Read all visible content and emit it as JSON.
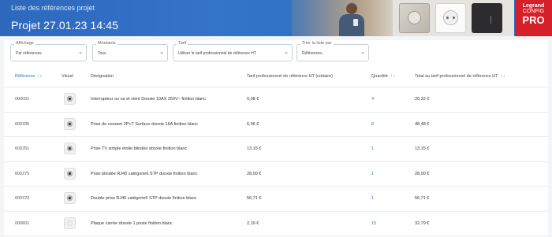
{
  "header": {
    "subtitle": "Liste des références projet",
    "title": "Projet 27.01.23 14:45",
    "brand": {
      "line1": "Legrand",
      "line2": "CONFIG",
      "line3": "PRO"
    }
  },
  "filters": [
    {
      "label": "Affichage",
      "value": "Par références"
    },
    {
      "label": "Montants",
      "value": "Tous"
    },
    {
      "label": "Tarif",
      "value": "Utiliser le tarif professionnel de référence HT"
    },
    {
      "label": "Trier la liste par",
      "value": "Références"
    }
  ],
  "table": {
    "columns": {
      "reference": "Référence",
      "visual": "Visuel",
      "designation": "Désignation",
      "unit_price": "Tarif professionnel de référence HT (unitaire)",
      "quantity": "Quantité",
      "total": "Total au tarif professionnel de référence HT"
    },
    "sort_icon": "↑↓",
    "rows": [
      {
        "ref": "000001",
        "designation": "Interrupteur ou va et vient Dooxie 10AX 250V~ finition blanc",
        "unit_price": "0,08 €",
        "quantity": "4",
        "total": "20,32 €",
        "icon": "switch-thumbnail"
      },
      {
        "ref": "600335",
        "designation": "Prise de courant 2P+T Surface dooxie 16A finition blanc",
        "unit_price": "6,06 €",
        "quantity": "8",
        "total": "48,48 €",
        "icon": "socket-thumbnail"
      },
      {
        "ref": "600351",
        "designation": "Prise TV simple étoile blindée dooxie finition blanc",
        "unit_price": "13,15 €",
        "quantity": "1",
        "total": "13,15 €",
        "icon": "tv-socket-thumbnail"
      },
      {
        "ref": "600275",
        "designation": "Prise blindée RJ45 catégorie6 STP dooxie finition blanc",
        "unit_price": "28,00 €",
        "quantity": "1",
        "total": "28,00 €",
        "icon": "rj45-thumbnail"
      },
      {
        "ref": "600370",
        "designation": "Double prise RJ45 catégorie6 STP dooxie finition blanc",
        "unit_price": "56,71 €",
        "quantity": "1",
        "total": "56,71 €",
        "icon": "double-rj45-thumbnail"
      },
      {
        "ref": "000801",
        "designation": "Plaque carrée dooxie 1 poste finition blanc",
        "unit_price": "2,19 €",
        "quantity": "15",
        "total": "32,79 €",
        "icon": "plate-thumbnail"
      }
    ]
  },
  "colors": {
    "accent": "#2f6fc4",
    "brand": "#d71f2a"
  }
}
